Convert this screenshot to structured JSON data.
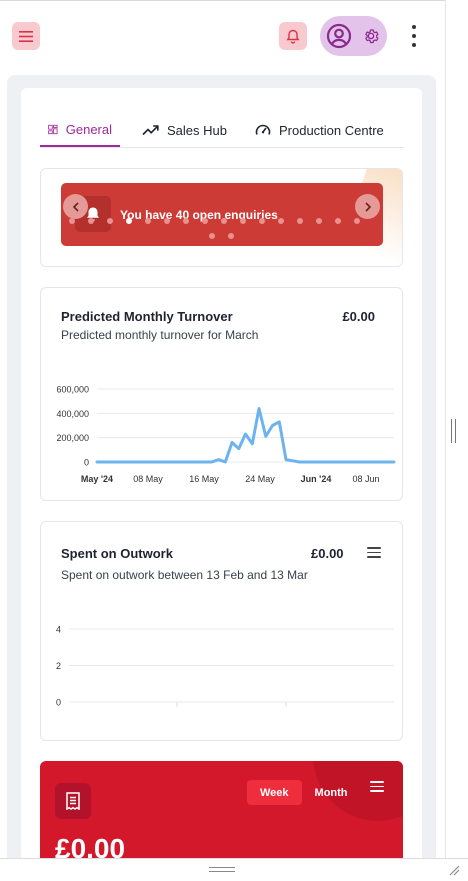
{
  "tabs": [
    {
      "label": "General",
      "icon": "dashboard-icon",
      "active": true
    },
    {
      "label": "Sales Hub",
      "icon": "trending-up-icon",
      "active": false
    },
    {
      "label": "Production Centre",
      "icon": "speedometer-icon",
      "active": false
    }
  ],
  "banner": {
    "text": "You have 40 open enquiries",
    "icon": "bell-icon",
    "dot_count": 18,
    "active_dot": 3
  },
  "turnover": {
    "title": "Predicted Monthly Turnover",
    "subtitle": "Predicted monthly turnover for March",
    "value": "£0.00"
  },
  "outwork": {
    "title": "Spent on Outwork",
    "subtitle": "Spent on outwork between 13 Feb and 13 Mar",
    "value": "£0.00"
  },
  "sales_card": {
    "week_label": "Week",
    "month_label": "Month",
    "active_period": "Week",
    "amount": "£0.00"
  },
  "colors": {
    "accent": "#9c2a9b",
    "banner_red": "#cc3b36",
    "card_red": "#d4182c",
    "line_blue": "#6db4ee"
  },
  "chart_data": [
    {
      "type": "line",
      "title": "",
      "x": [
        "May '24",
        "08 May",
        "16 May",
        "24 May",
        "Jun '24",
        "08 Jun"
      ],
      "ylim": [
        0,
        600000
      ],
      "y_ticks": [
        "600,000",
        "400,000",
        "200,000",
        "0"
      ],
      "x_ticks": [
        "May '24",
        "08 May",
        "16 May",
        "24 May",
        "Jun '24",
        "08 Jun"
      ],
      "series": [
        {
          "values": [
            0,
            0,
            0,
            0,
            0,
            0,
            0,
            0,
            0,
            0,
            0,
            0,
            0,
            0,
            0,
            0,
            0,
            0,
            20000,
            0,
            160000,
            110000,
            230000,
            150000,
            440000,
            210000,
            300000,
            330000,
            20000,
            10000,
            0,
            0,
            0,
            0,
            0,
            0,
            0,
            0,
            0,
            0,
            0,
            0,
            0,
            0,
            0
          ]
        }
      ],
      "grid": true,
      "legend": "none"
    },
    {
      "type": "line",
      "title": "",
      "ylim": [
        0,
        4
      ],
      "y_ticks": [
        "4",
        "2",
        "0"
      ],
      "series": [],
      "grid": true,
      "legend": "none"
    }
  ]
}
